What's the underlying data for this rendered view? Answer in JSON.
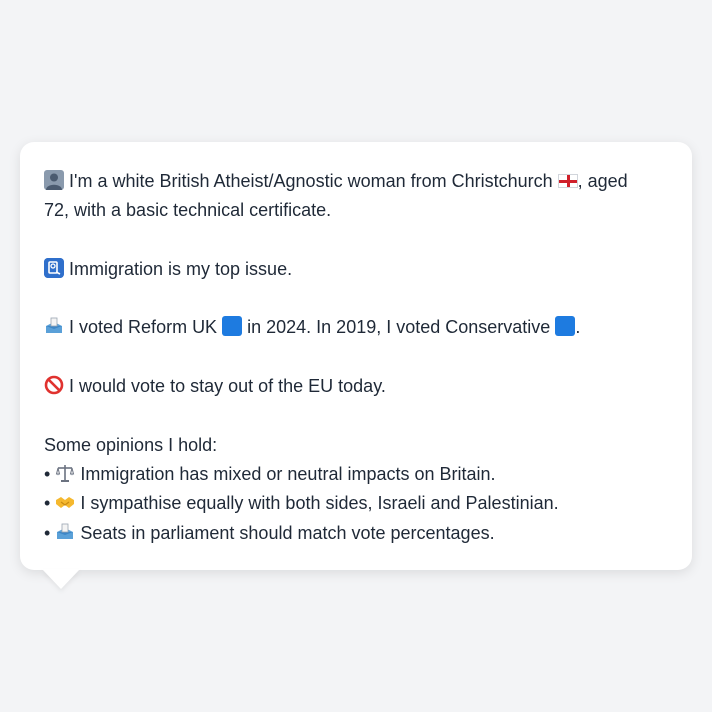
{
  "profile": {
    "intro_pre": "I'm a white British Atheist/Agnostic woman from Christchurch",
    "intro_post": ", aged",
    "intro_line2": "72, with a basic technical certificate.",
    "issue": "Immigration is my top issue.",
    "vote_a": "I voted Reform UK",
    "vote_b": "in 2024. In 2019, I voted Conservative",
    "vote_c": ".",
    "eu": "I would vote to stay out of the EU today.",
    "opinions_heading": "Some opinions I hold:",
    "bullet": "•",
    "opinions": [
      "Immigration has mixed or neutral impacts on Britain.",
      "I sympathise equally with both sides, Israeli and Palestinian.",
      "Seats in parliament should match vote percentages."
    ]
  },
  "icons": {
    "intro": "person-icon",
    "flag": "england-flag-icon",
    "issue": "passport-control-icon",
    "vote": "ballot-box-icon",
    "party_color_reform": "#1e7be0",
    "party_color_conservative": "#1e7be0",
    "eu": "prohibited-icon",
    "opinion_icons": [
      "balance-scale-icon",
      "handshake-icon",
      "ballot-box-icon"
    ]
  }
}
